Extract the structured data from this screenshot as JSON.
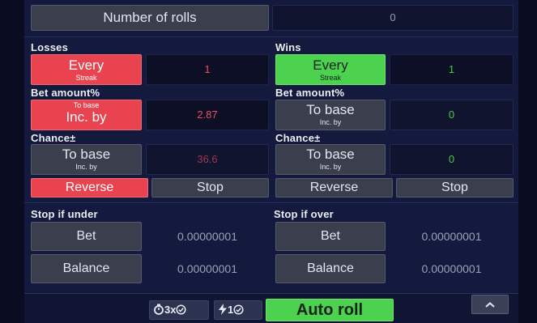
{
  "number_of_rolls": {
    "label": "Number of rolls",
    "value": "0"
  },
  "losses": {
    "title": "Losses",
    "mode_label": "Every",
    "mode_sub": "Streak",
    "count": "1",
    "bet_amount_title": "Bet amount%",
    "bet_mode_top": "To base",
    "bet_mode_label": "Inc. by",
    "bet_value": "2.87",
    "chance_title": "Chance±",
    "chance_mode_label": "To base",
    "chance_mode_sub": "Inc. by",
    "chance_value": "36.6",
    "reverse_label": "Reverse",
    "stop_label": "Stop"
  },
  "wins": {
    "title": "Wins",
    "mode_label": "Every",
    "mode_sub": "Streak",
    "count": "1",
    "bet_amount_title": "Bet amount%",
    "bet_mode_label": "To base",
    "bet_mode_sub": "Inc. by",
    "bet_value": "0",
    "chance_title": "Chance±",
    "chance_mode_label": "To base",
    "chance_mode_sub": "Inc. by",
    "chance_value": "0",
    "reverse_label": "Reverse",
    "stop_label": "Stop"
  },
  "stop_if_under": {
    "title": "Stop if under",
    "bet_label": "Bet",
    "bet_value": "0.00000001",
    "balance_label": "Balance",
    "balance_value": "0.00000001"
  },
  "stop_if_over": {
    "title": "Stop if over",
    "bet_label": "Bet",
    "bet_value": "0.00000001",
    "balance_label": "Balance",
    "balance_value": "0.00000001"
  },
  "footer": {
    "speed_label": "3x",
    "bolt_count": "1",
    "auto_roll_label": "Auto roll",
    "collapse_icon": "chevron-up-icon"
  },
  "colors": {
    "background": "#141a3d",
    "danger": "#e8434f",
    "success": "#4cd24e",
    "loss_value": "#f04c5e",
    "win_value": "#3fd13f"
  }
}
